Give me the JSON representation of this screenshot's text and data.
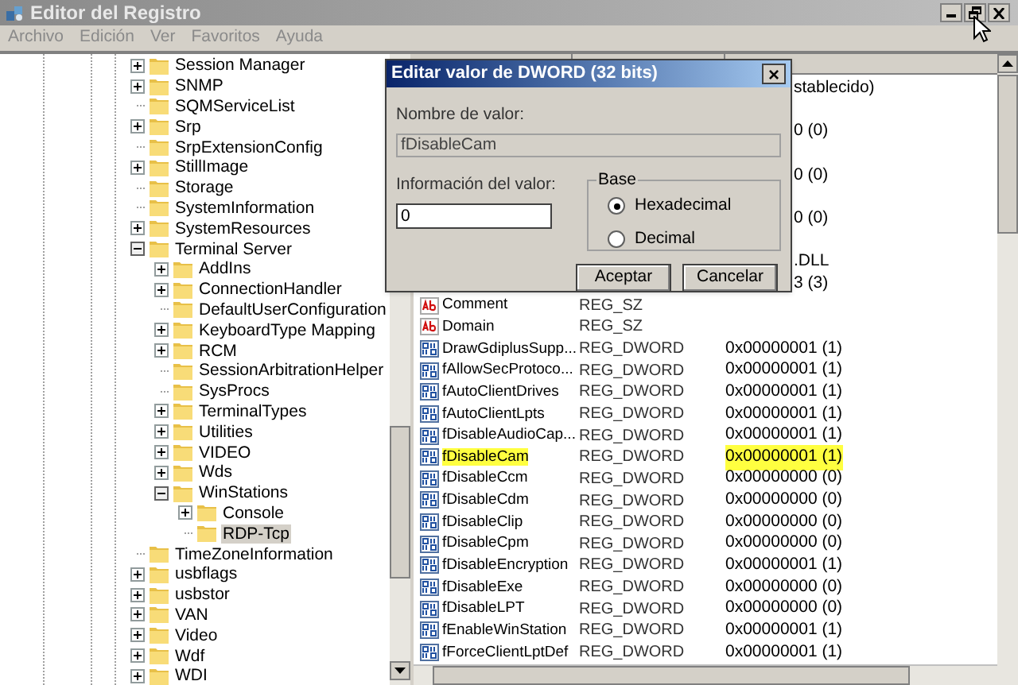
{
  "window": {
    "title": "Editor del Registro"
  },
  "menu": [
    {
      "label": "Archivo",
      "disabled": true
    },
    {
      "label": "Edición",
      "disabled": true
    },
    {
      "label": "Ver",
      "disabled": true
    },
    {
      "label": "Favoritos",
      "disabled": true
    },
    {
      "label": "Ayuda",
      "disabled": true
    }
  ],
  "tree": [
    {
      "label": "Session Manager",
      "expandable": true,
      "expanded": false,
      "selected": false
    },
    {
      "label": "SNMP",
      "expandable": true,
      "expanded": false,
      "selected": false
    },
    {
      "label": "SQMServiceList",
      "expandable": false,
      "expanded": false,
      "selected": false
    },
    {
      "label": "Srp",
      "expandable": true,
      "expanded": false,
      "selected": false
    },
    {
      "label": "SrpExtensionConfig",
      "expandable": false,
      "expanded": false,
      "selected": false
    },
    {
      "label": "StillImage",
      "expandable": true,
      "expanded": false,
      "selected": false
    },
    {
      "label": "Storage",
      "expandable": false,
      "expanded": false,
      "selected": false
    },
    {
      "label": "SystemInformation",
      "expandable": false,
      "expanded": false,
      "selected": false
    },
    {
      "label": "SystemResources",
      "expandable": true,
      "expanded": false,
      "selected": false
    },
    {
      "label": "Terminal Server",
      "expandable": true,
      "expanded": true,
      "selected": false,
      "children": [
        {
          "label": "AddIns",
          "expandable": true,
          "expanded": false,
          "selected": false
        },
        {
          "label": "ConnectionHandler",
          "expandable": true,
          "expanded": false,
          "selected": false
        },
        {
          "label": "DefaultUserConfiguration",
          "expandable": false,
          "expanded": false,
          "selected": false
        },
        {
          "label": "KeyboardType Mapping",
          "expandable": true,
          "expanded": false,
          "selected": false
        },
        {
          "label": "RCM",
          "expandable": true,
          "expanded": false,
          "selected": false
        },
        {
          "label": "SessionArbitrationHelper",
          "expandable": false,
          "expanded": false,
          "selected": false
        },
        {
          "label": "SysProcs",
          "expandable": false,
          "expanded": false,
          "selected": false
        },
        {
          "label": "TerminalTypes",
          "expandable": true,
          "expanded": false,
          "selected": false
        },
        {
          "label": "Utilities",
          "expandable": true,
          "expanded": false,
          "selected": false
        },
        {
          "label": "VIDEO",
          "expandable": true,
          "expanded": false,
          "selected": false
        },
        {
          "label": "Wds",
          "expandable": true,
          "expanded": false,
          "selected": false
        },
        {
          "label": "WinStations",
          "expandable": true,
          "expanded": true,
          "selected": false,
          "children": [
            {
              "label": "Console",
              "expandable": true,
              "expanded": false,
              "selected": false
            },
            {
              "label": "RDP-Tcp",
              "expandable": false,
              "expanded": false,
              "selected": true
            }
          ]
        }
      ]
    },
    {
      "label": "TimeZoneInformation",
      "expandable": false,
      "expanded": false,
      "selected": false
    },
    {
      "label": "usbflags",
      "expandable": true,
      "expanded": false,
      "selected": false
    },
    {
      "label": "usbstor",
      "expandable": true,
      "expanded": false,
      "selected": false
    },
    {
      "label": "VAN",
      "expandable": true,
      "expanded": false,
      "selected": false
    },
    {
      "label": "Video",
      "expandable": true,
      "expanded": false,
      "selected": false
    },
    {
      "label": "Wdf",
      "expandable": true,
      "expanded": false,
      "selected": false
    },
    {
      "label": "WDI",
      "expandable": true,
      "expanded": false,
      "selected": false
    }
  ],
  "values": [
    {
      "kind": "covered",
      "data": "stablecido)",
      "highlighted": false
    },
    {
      "kind": "covered",
      "highlighted": false
    },
    {
      "kind": "covered",
      "data": "0 (0)",
      "highlighted": false
    },
    {
      "kind": "covered",
      "highlighted": false
    },
    {
      "kind": "covered",
      "data": "0 (0)",
      "highlighted": false
    },
    {
      "kind": "covered",
      "highlighted": false
    },
    {
      "kind": "covered",
      "data": "0 (0)",
      "highlighted": false
    },
    {
      "kind": "covered",
      "highlighted": false
    },
    {
      "kind": "covered",
      "data": ".DLL",
      "highlighted": false
    },
    {
      "kind": "covered",
      "data": "3 (3)",
      "highlighted": false
    },
    {
      "kind": "string",
      "name": "Comment",
      "type": "REG_SZ",
      "highlighted": false
    },
    {
      "kind": "string",
      "name": "Domain",
      "type": "REG_SZ",
      "highlighted": false
    },
    {
      "kind": "dword",
      "name": "DrawGdiplusSupp...",
      "type": "REG_DWORD",
      "data": "0x00000001 (1)",
      "highlighted": false
    },
    {
      "kind": "dword",
      "name": "fAllowSecProtoco...",
      "type": "REG_DWORD",
      "data": "0x00000001 (1)",
      "highlighted": false
    },
    {
      "kind": "dword",
      "name": "fAutoClientDrives",
      "type": "REG_DWORD",
      "data": "0x00000001 (1)",
      "highlighted": false
    },
    {
      "kind": "dword",
      "name": "fAutoClientLpts",
      "type": "REG_DWORD",
      "data": "0x00000001 (1)",
      "highlighted": false
    },
    {
      "kind": "dword",
      "name": "fDisableAudioCap...",
      "type": "REG_DWORD",
      "data": "0x00000001 (1)",
      "highlighted": false
    },
    {
      "kind": "dword",
      "name": "fDisableCam",
      "type": "REG_DWORD",
      "data": "0x00000001 (1)",
      "highlighted": true
    },
    {
      "kind": "dword",
      "name": "fDisableCcm",
      "type": "REG_DWORD",
      "data": "0x00000000 (0)",
      "highlighted": false
    },
    {
      "kind": "dword",
      "name": "fDisableCdm",
      "type": "REG_DWORD",
      "data": "0x00000000 (0)",
      "highlighted": false
    },
    {
      "kind": "dword",
      "name": "fDisableClip",
      "type": "REG_DWORD",
      "data": "0x00000000 (0)",
      "highlighted": false
    },
    {
      "kind": "dword",
      "name": "fDisableCpm",
      "type": "REG_DWORD",
      "data": "0x00000000 (0)",
      "highlighted": false
    },
    {
      "kind": "dword",
      "name": "fDisableEncryption",
      "type": "REG_DWORD",
      "data": "0x00000001 (1)",
      "highlighted": false
    },
    {
      "kind": "dword",
      "name": "fDisableExe",
      "type": "REG_DWORD",
      "data": "0x00000000 (0)",
      "highlighted": false
    },
    {
      "kind": "dword",
      "name": "fDisableLPT",
      "type": "REG_DWORD",
      "data": "0x00000000 (0)",
      "highlighted": false
    },
    {
      "kind": "dword",
      "name": "fEnableWinStation",
      "type": "REG_DWORD",
      "data": "0x00000001 (1)",
      "highlighted": false
    },
    {
      "kind": "dword",
      "name": "fForceClientLptDef",
      "type": "REG_DWORD",
      "data": "0x00000001 (1)",
      "highlighted": false
    }
  ],
  "dialog": {
    "title": "Editar valor de DWORD (32 bits)",
    "close": "×",
    "name_label": "Nombre de valor:",
    "name_value": "fDisableCam",
    "data_label": "Información del valor:",
    "data_value": "0",
    "base": {
      "label": "Base",
      "options": [
        {
          "label": "Hexadecimal",
          "selected": true
        },
        {
          "label": "Decimal",
          "selected": false
        }
      ]
    },
    "buttons": [
      "Aceptar",
      "Cancelar"
    ]
  }
}
